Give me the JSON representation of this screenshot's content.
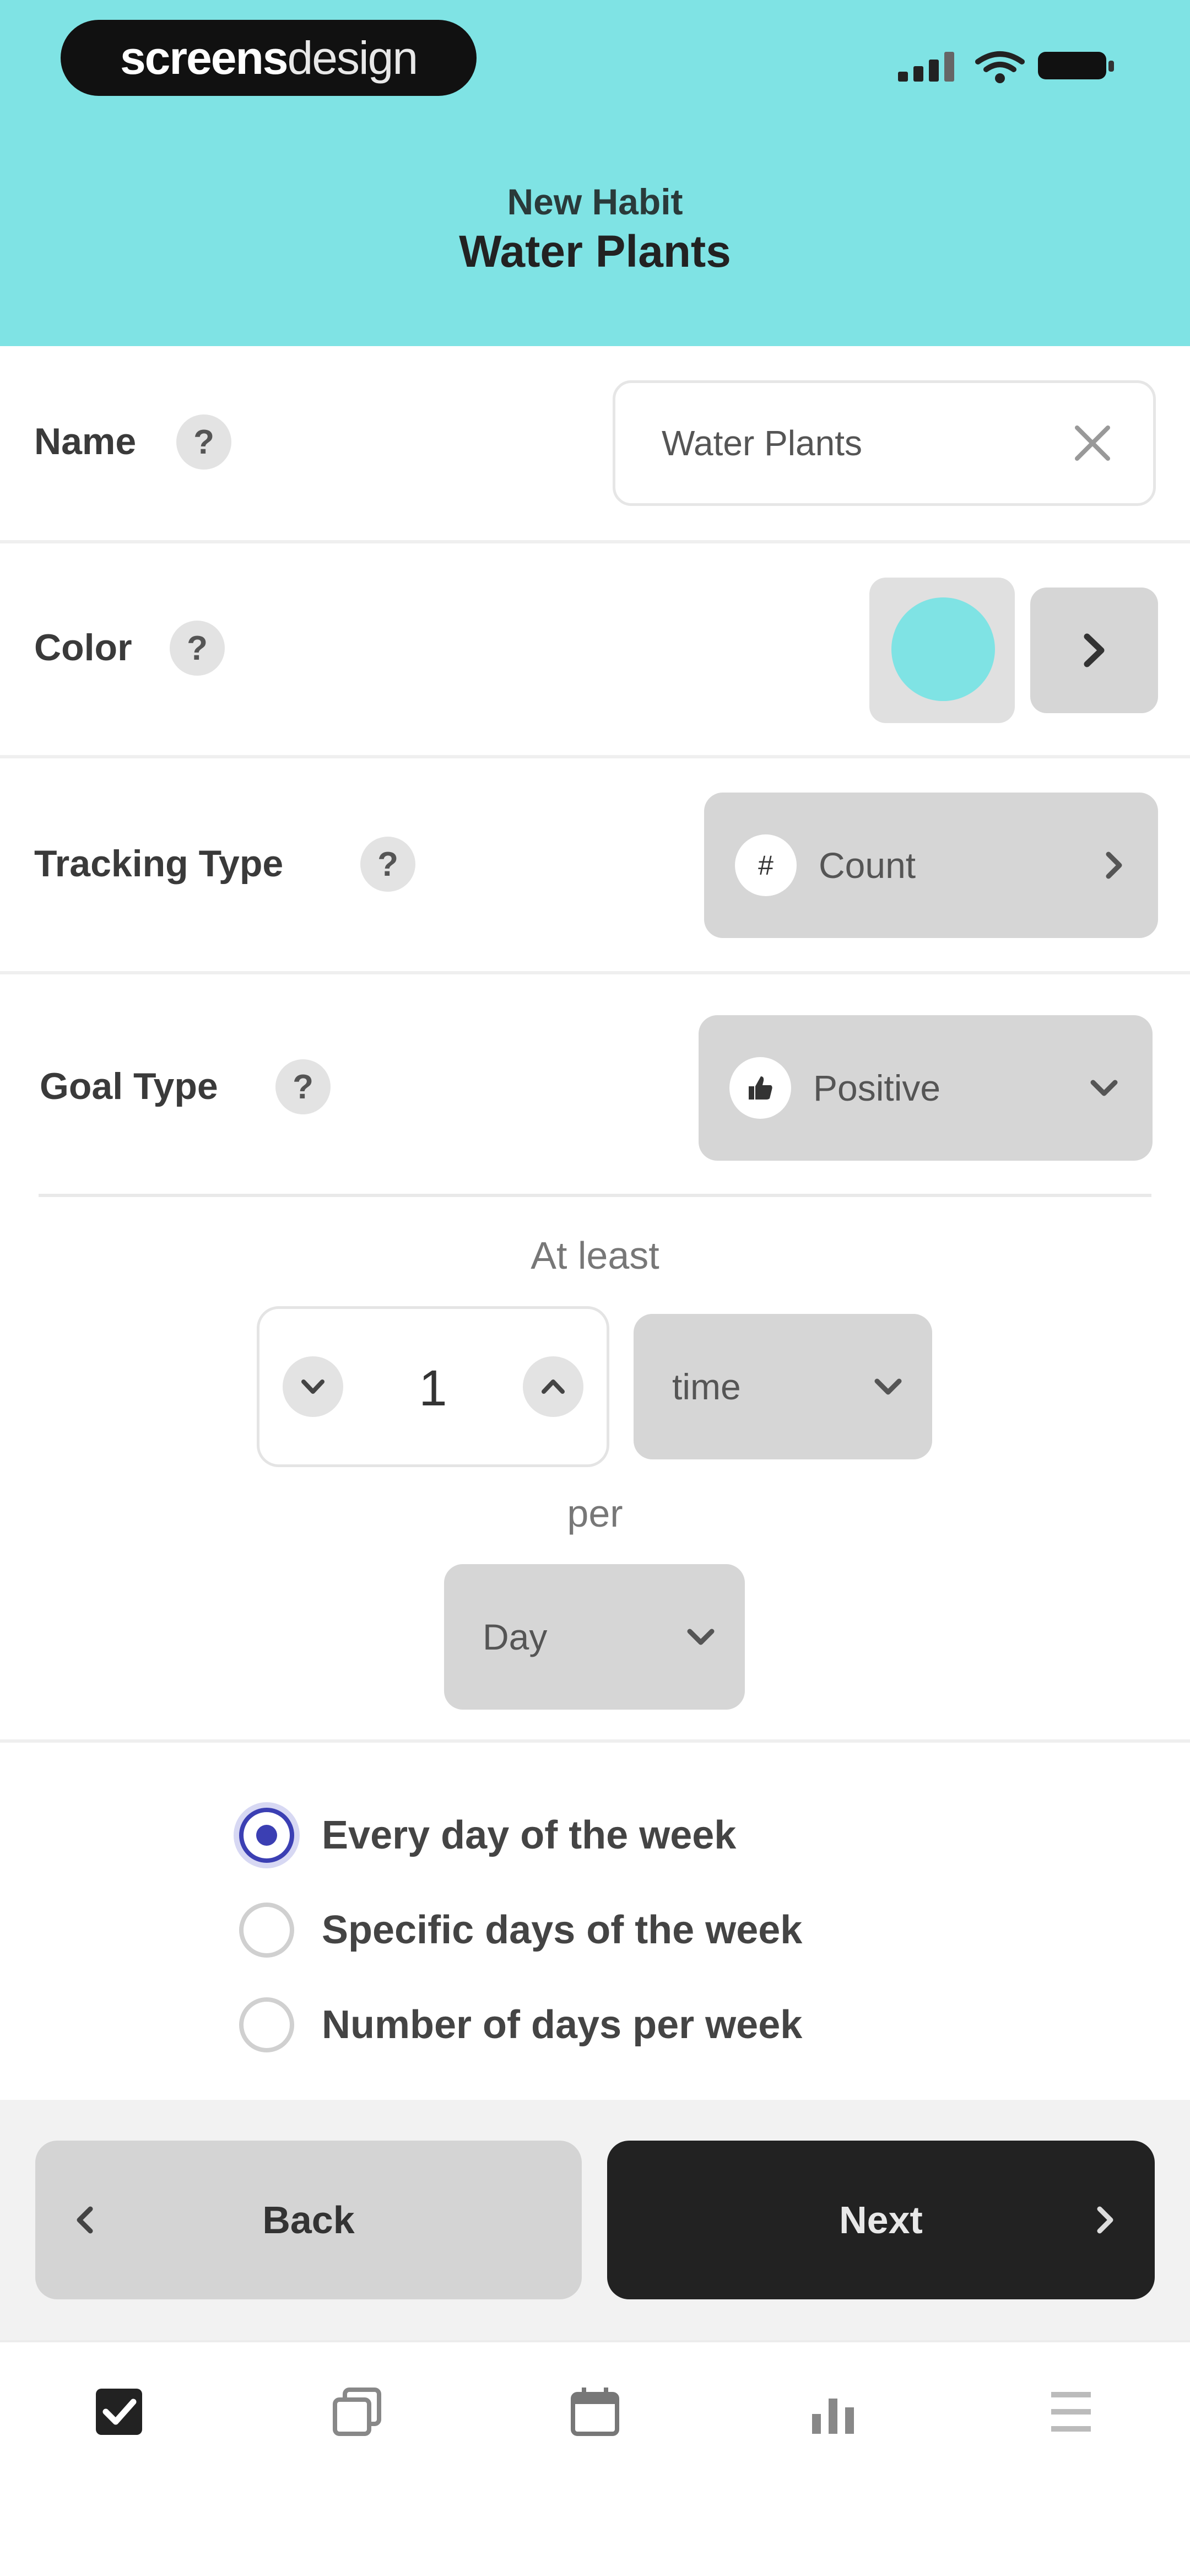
{
  "status_bar": {
    "logo_bold": "screens",
    "logo_light": "design"
  },
  "header": {
    "subtitle": "New Habit",
    "title": "Water Plants",
    "background": "#7fe3e4"
  },
  "form": {
    "name": {
      "label": "Name",
      "help": "?",
      "value": "Water Plants"
    },
    "color": {
      "label": "Color",
      "help": "?",
      "value": "#7fe3e4"
    },
    "tracking_type": {
      "label": "Tracking Type",
      "help": "?",
      "value": "Count",
      "icon": "hash-icon"
    },
    "goal_type": {
      "label": "Goal Type",
      "help": "?",
      "value": "Positive",
      "icon": "thumbs-up-icon"
    },
    "goal": {
      "prefix": "At least",
      "amount": "1",
      "unit": "time",
      "per_label": "per",
      "period": "Day"
    },
    "frequency": {
      "options": [
        {
          "label": "Every day of the week",
          "selected": true
        },
        {
          "label": "Specific days of the week",
          "selected": false
        },
        {
          "label": "Number of days per week",
          "selected": false
        }
      ]
    }
  },
  "actions": {
    "back": "Back",
    "next": "Next"
  },
  "tab_bar": {
    "items": [
      "checkbox-icon",
      "copy-icon",
      "calendar-icon",
      "stats-icon",
      "list-icon"
    ]
  }
}
